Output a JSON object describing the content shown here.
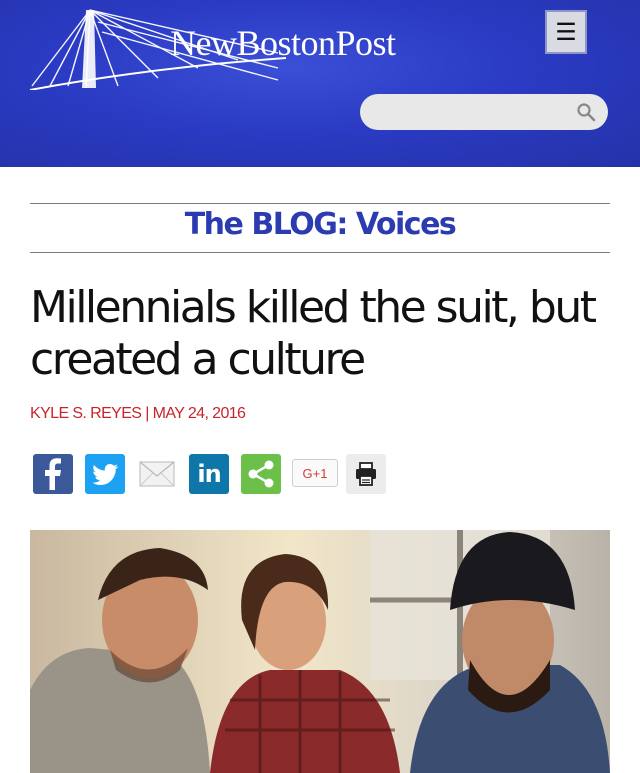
{
  "header": {
    "site_name": "NewBostonPost",
    "menu_icon": "hamburger-menu-icon",
    "search": {
      "placeholder": "",
      "icon": "search-icon"
    },
    "brand_color": "#2b3bc4"
  },
  "section": {
    "title": "The BLOG: Voices",
    "color": "#2b3bb0"
  },
  "article": {
    "headline": "Millennials killed the suit, but created a culture",
    "byline": "KYLE S. REYES | MAY 24, 2016",
    "byline_color": "#c8242b"
  },
  "share": {
    "buttons": [
      {
        "name": "facebook",
        "icon": "facebook-icon",
        "color": "#3b5998"
      },
      {
        "name": "twitter",
        "icon": "twitter-icon",
        "color": "#1da1f2"
      },
      {
        "name": "email",
        "icon": "email-icon",
        "color": "#ffffff"
      },
      {
        "name": "linkedin",
        "icon": "linkedin-icon",
        "label": "in",
        "color": "#0e76a8"
      },
      {
        "name": "share",
        "icon": "share-icon",
        "color": "#6cc04a"
      },
      {
        "name": "google-plus",
        "icon": "google-plus-icon",
        "label": "G+1",
        "color": "#d23f31"
      },
      {
        "name": "print",
        "icon": "print-icon",
        "color": "#ececec"
      }
    ]
  },
  "image": {
    "description_icon": "article-photo"
  }
}
